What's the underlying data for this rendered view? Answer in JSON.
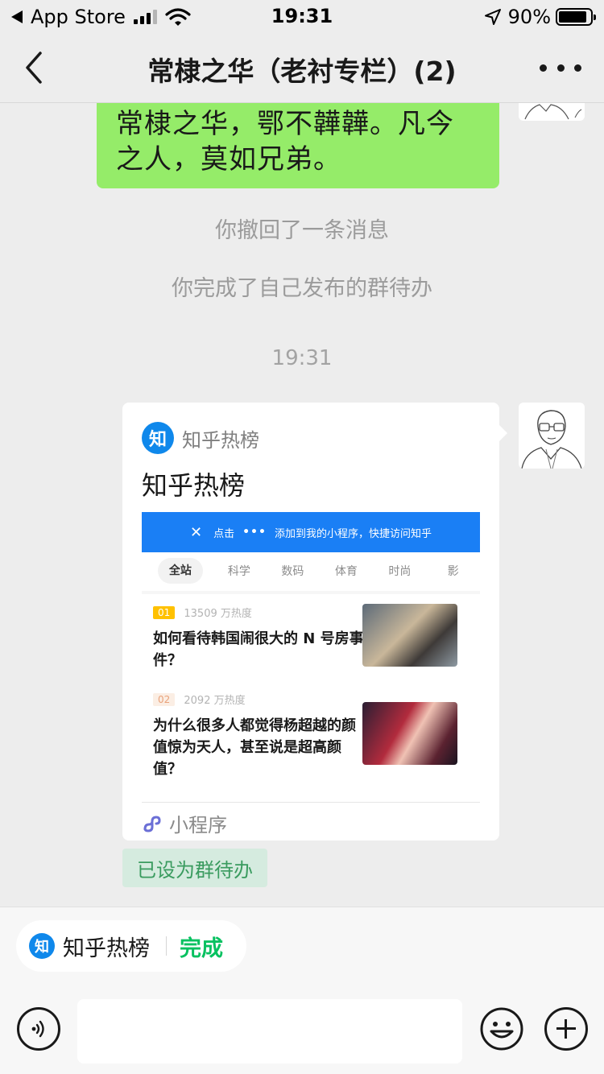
{
  "status_bar": {
    "back_app": "App Store",
    "time": "19:31",
    "battery": "90%",
    "battery_level": 0.9,
    "icons": [
      "back-triangle-icon",
      "signal-icon",
      "wifi-icon",
      "location-arrow-icon",
      "battery-icon"
    ]
  },
  "nav": {
    "title": "常棣之华（老衬专栏）(2)",
    "icons": [
      "chevron-left-icon",
      "more-icon"
    ]
  },
  "chat": {
    "partial_message": "常棣之华，鄂不韡韡。凡今之人，莫如兄弟。",
    "system_messages": [
      "你撤回了一条消息",
      "你完成了自己发布的群待办"
    ],
    "timestamp": "19:31",
    "card": {
      "app_logo": "知",
      "app_name": "知乎热榜",
      "title": "知乎热榜",
      "preview": {
        "banner": {
          "prefix": "点击",
          "dots": "•••",
          "suffix": "添加到我的小程序，快捷访问知乎"
        },
        "tabs": [
          "全站",
          "科学",
          "数码",
          "体育",
          "时尚",
          "影"
        ],
        "items": [
          {
            "rank": "01",
            "heat": "13509 万热度",
            "title": "如何看待韩国闹很大的 N 号房事件？"
          },
          {
            "rank": "02",
            "heat": "2092 万热度",
            "title": "为什么很多人都觉得杨超越的颜值惊为天人，甚至说是超高颜值？"
          }
        ]
      },
      "footer_label": "小程序"
    },
    "todo_tag": "已设为群待办"
  },
  "bottom": {
    "todo_pill": {
      "logo": "知",
      "name": "知乎热榜",
      "action": "完成"
    },
    "icons": [
      "voice-icon",
      "emoji-icon",
      "plus-icon"
    ]
  },
  "colors": {
    "wechat_green": "#07c160",
    "bubble_green": "#95ec69",
    "zhihu_blue": "#0f88eb",
    "background": "#ededed"
  }
}
